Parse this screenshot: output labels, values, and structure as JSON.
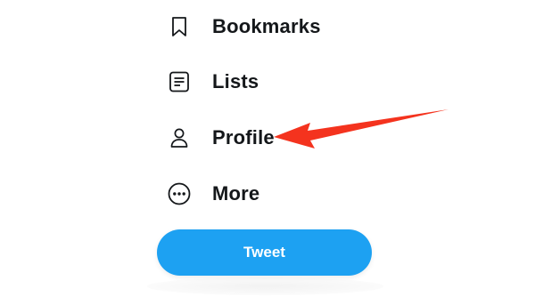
{
  "nav": {
    "items": [
      {
        "label": "Bookmarks",
        "icon": "bookmark-icon"
      },
      {
        "label": "Lists",
        "icon": "list-icon"
      },
      {
        "label": "Profile",
        "icon": "profile-icon"
      },
      {
        "label": "More",
        "icon": "more-icon"
      }
    ]
  },
  "tweet_button": {
    "label": "Tweet"
  },
  "colors": {
    "accent": "#1da1f2",
    "text": "#14171a",
    "annotation_arrow": "#f4331e"
  },
  "annotation": {
    "icon": "red-arrow-icon"
  }
}
